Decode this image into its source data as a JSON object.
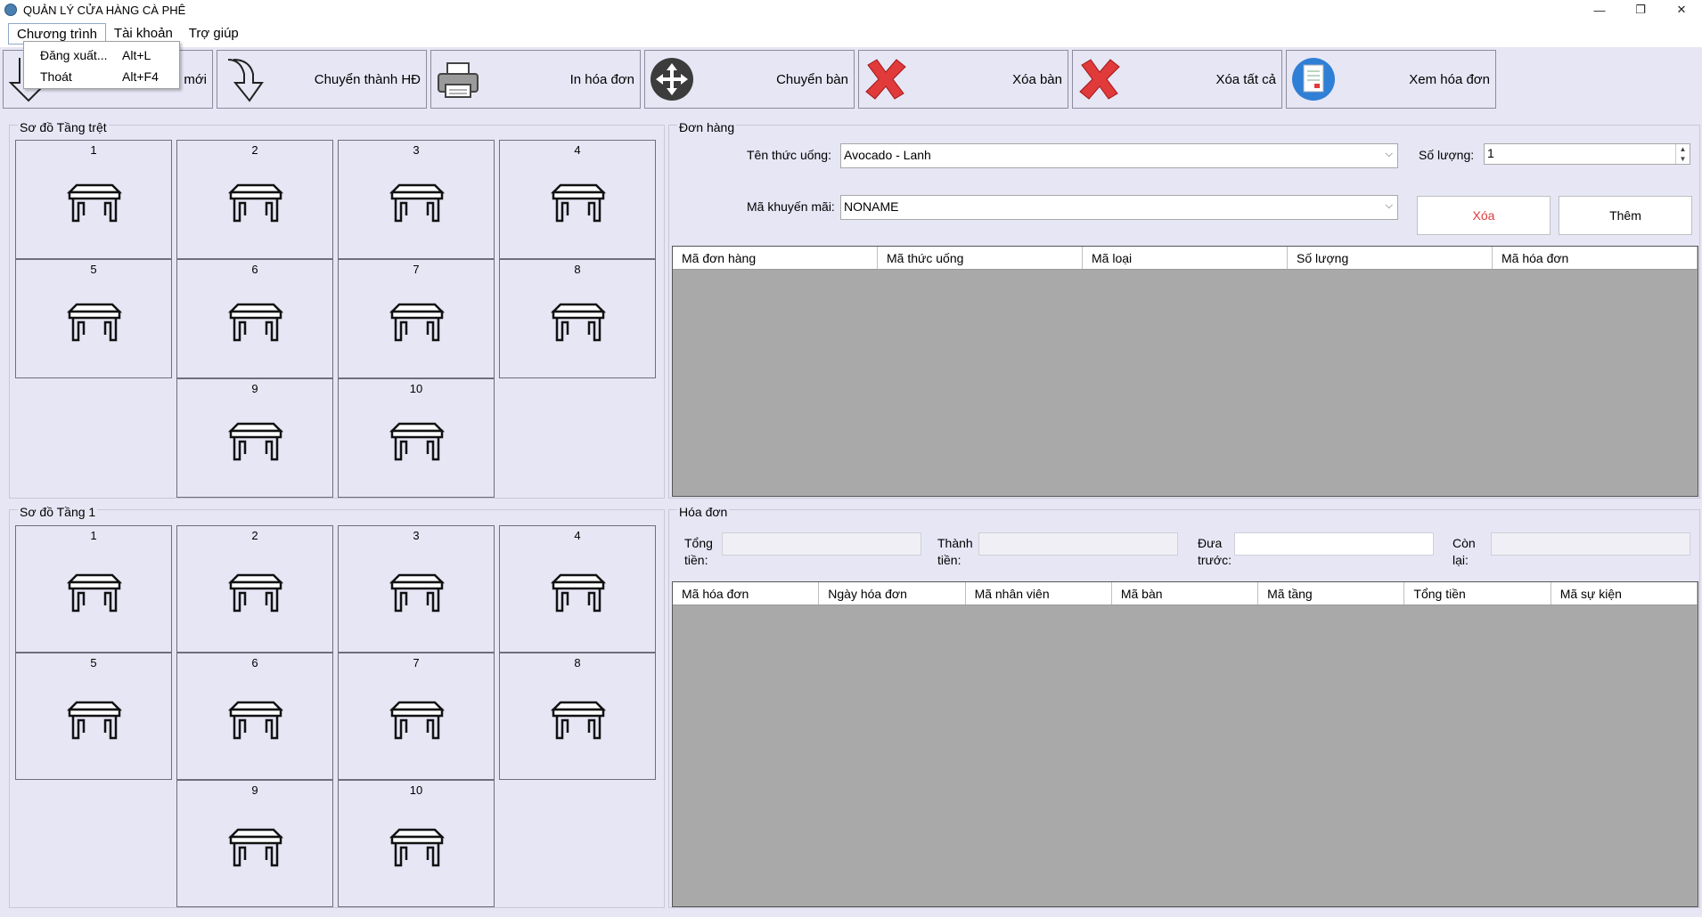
{
  "window": {
    "title": "QUẢN LÝ CỬA HÀNG CÀ PHÊ",
    "min": "—",
    "max": "❐",
    "close": "✕"
  },
  "menu": {
    "items": [
      "Chương trình",
      "Tài khoản",
      "Trợ giúp"
    ],
    "dropdown": [
      {
        "label": "Đăng xuất...",
        "shortcut": "Alt+L"
      },
      {
        "label": "Thoát",
        "shortcut": "Alt+F4"
      }
    ]
  },
  "toolbar": [
    {
      "label": "mới",
      "icon": "new-order-arrow-icon"
    },
    {
      "label": "Chuyển thành HĐ",
      "icon": "convert-arrow-icon"
    },
    {
      "label": "In hóa đơn",
      "icon": "printer-icon"
    },
    {
      "label": "Chuyển bàn",
      "icon": "move-icon"
    },
    {
      "label": "Xóa bàn",
      "icon": "delete-x-icon"
    },
    {
      "label": "Xóa tất cả",
      "icon": "delete-all-x-icon"
    },
    {
      "label": "Xem hóa đơn",
      "icon": "invoice-icon"
    }
  ],
  "floors": [
    {
      "title": "Sơ đồ Tầng trệt",
      "tables": [
        "1",
        "2",
        "3",
        "4",
        "5",
        "6",
        "7",
        "8",
        "9",
        "10"
      ]
    },
    {
      "title": "Sơ đồ Tầng 1",
      "tables": [
        "1",
        "2",
        "3",
        "4",
        "5",
        "6",
        "7",
        "8",
        "9",
        "10"
      ]
    }
  ],
  "order": {
    "title": "Đơn hàng",
    "drink_label": "Tên thức uống:",
    "drink_value": "Avocado - Lanh",
    "qty_label": "Số lượng:",
    "qty_value": "1",
    "promo_label": "Mã khuyến mãi:",
    "promo_value": "NONAME",
    "delete_btn": "Xóa",
    "add_btn": "Thêm",
    "columns": [
      "Mã đơn hàng",
      "Mã thức uống",
      "Mã loại",
      "Số lượng",
      "Mã hóa đơn"
    ]
  },
  "invoice": {
    "title": "Hóa đơn",
    "total_label_1": "Tổng",
    "total_label_2": "tiền:",
    "pay_label_1": "Thành",
    "pay_label_2": "tiền:",
    "paid_label_1": "Đưa",
    "paid_label_2": "trước:",
    "remain_label_1": "Còn",
    "remain_label_2": "lại:",
    "columns": [
      "Mã hóa đơn",
      "Ngày hóa đơn",
      "Mã nhân viên",
      "Mã bàn",
      "Mã tầng",
      "Tổng tiền",
      "Mã sự kiện"
    ]
  },
  "colors": {
    "background": "#e6e6f5",
    "grid_body": "#a9a9a9",
    "delete_red": "#e03a3a"
  }
}
